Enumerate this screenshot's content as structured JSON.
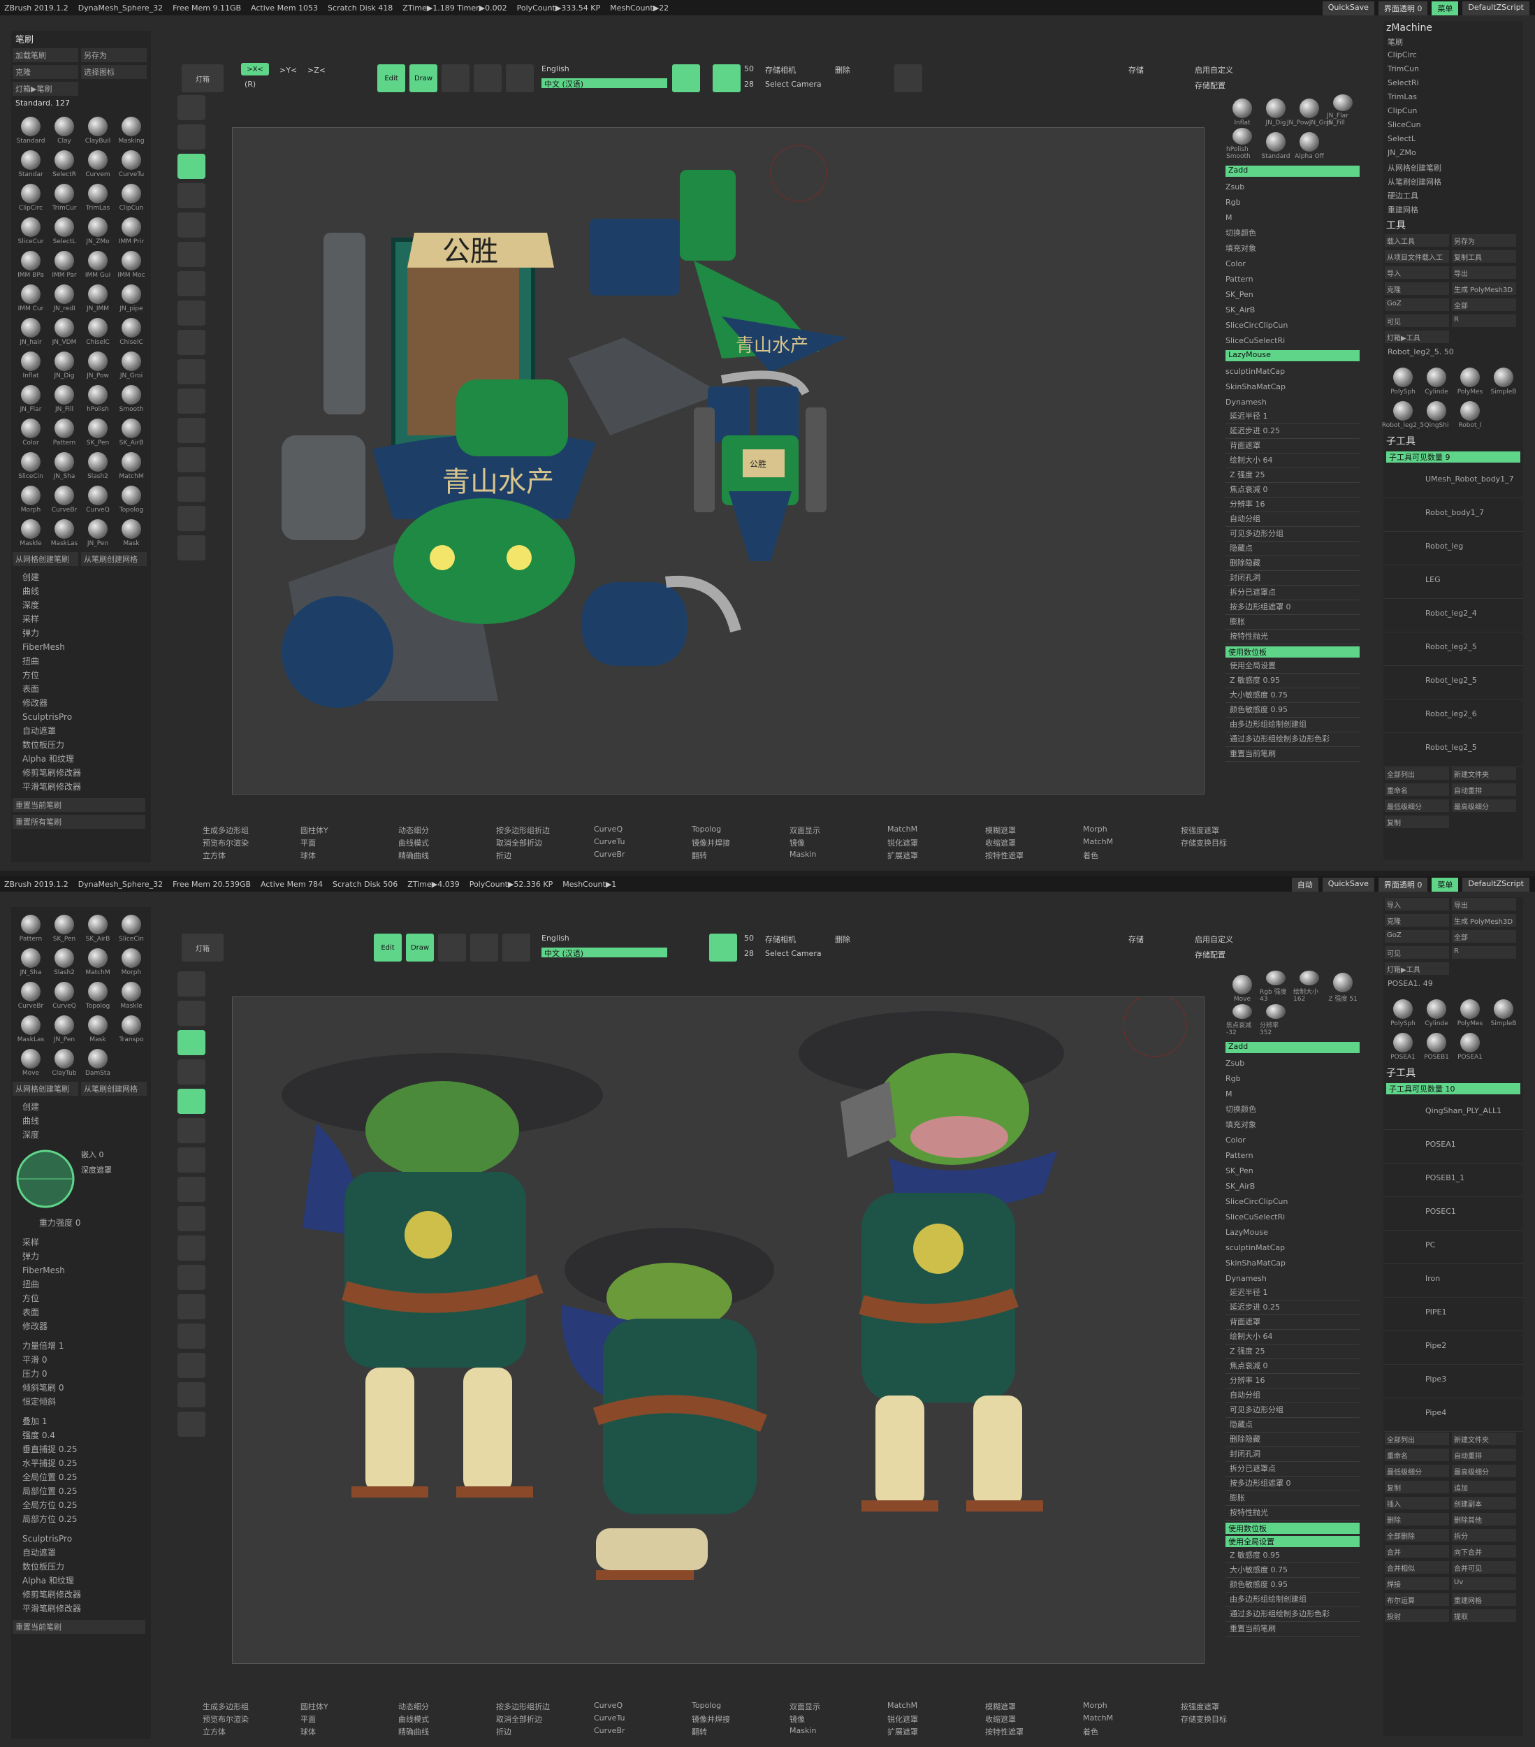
{
  "shot1": {
    "titlebar": [
      "ZBrush 2019.1.2",
      "DynaMesh_Sphere_32",
      "Free Mem 9.11GB",
      "Active Mem 1053",
      "Scratch Disk 418",
      "ZTime▶1.189 Timer▶0.002",
      "PolyCount▶333.54 KP",
      "MeshCount▶22"
    ],
    "tb_right": [
      "QuickSave",
      "界面透明 0",
      "菜单",
      "DefaultZScript"
    ],
    "left_title": "笔刷",
    "left_btns": [
      "加载笔刷",
      "另存为",
      "克隆",
      "选择图标",
      "灯箱▶笔刷"
    ],
    "brush_sel": "Standard. 127",
    "brushes": [
      "Standard",
      "Clay",
      "ClayBuil",
      "Masking",
      "Standar",
      "SelectR",
      "Curvem",
      "CurveTu",
      "ClipCirc",
      "TrimCur",
      "TrimLas",
      "ClipCun",
      "SliceCur",
      "SelectL",
      "JN_ZMo",
      "IMM Prir",
      "IMM BPa",
      "IMM Par",
      "IMM Gui",
      "IMM Moc",
      "IMM Cur",
      "JN_redI",
      "JN_IMM",
      "JN_pipe",
      "JN_hair",
      "JN_VDM",
      "ChiselC",
      "ChiselC",
      "Inflat",
      "JN_Dig",
      "JN_Pow",
      "JN_Groi",
      "JN_Flar",
      "JN_Fill",
      "hPolish",
      "Smooth",
      "Color",
      "Pattern",
      "SK_Pen",
      "SK_AirB",
      "SliceCin",
      "JN_Sha",
      "Slash2",
      "MatchM",
      "Morph",
      "CurveBr",
      "CurveQ",
      "Topolog",
      "Maskle",
      "MaskLas",
      "JN_Pen",
      "Mask"
    ],
    "left_footer": [
      "从网格创建笔刷",
      "从笔刷创建网格"
    ],
    "left_list": [
      "创建",
      "曲线",
      "深度",
      "采样",
      "弹力",
      "FiberMesh",
      "扭曲",
      "方位",
      "表面",
      "修改器",
      "SculptrisPro",
      "自动遮罩",
      "数位板压力",
      "Alpha 和纹理",
      "修剪笔刷修改器",
      "平滑笔刷修改器"
    ],
    "left_bottom": [
      "重置当前笔刷",
      "重置所有笔刷"
    ],
    "shelf": {
      "btn1": "灯箱",
      "x_sym": ">X<",
      "r": "(R)",
      "y_sym": ">Y<",
      "z_sym": ">Z<",
      "edit": "Edit",
      "draw": "Draw",
      "lang_label": "English",
      "lang": "中文 (汉语)",
      "num1": "50",
      "num2": "28",
      "store_cam": "存储相机",
      "delete": "删除",
      "select_cam": "Select Camera",
      "save": "存储",
      "custom": "启用自定义",
      "store_cfg": "存储配置"
    },
    "viewport_text": [
      "公胜",
      "青山水产",
      "青山水产",
      "公胜"
    ],
    "right_brushes": [
      "Inflat",
      "JN_Dig",
      "JN_PowJN_Groi",
      "JN_Flar JN_Fill",
      "hPolish Smooth",
      "Standard",
      "Alpha Off"
    ],
    "right_rows": [
      "Zadd",
      "Zsub",
      "Rgb",
      "M",
      "切换颜色",
      "填充对象",
      "Color",
      "Pattern",
      "SK_Pen",
      "SK_AirB",
      "SliceCircClipCun",
      "SliceCuSelectRi",
      "LazyMouse",
      "sculptinMatCap",
      "SkinShaMatCap",
      "Dynamesh"
    ],
    "right_sliders": [
      "延迟半径 1",
      "延迟步进 0.25",
      "背面遮罩",
      "绘制大小 64",
      "Z 强度 25",
      "焦点衰减 0",
      "分辨率 16",
      "自动分组",
      "可见多边形分组",
      "隐藏点",
      "删除隐藏",
      "封闭孔洞",
      "拆分已遮罩点",
      "按多边形组遮罩 0",
      "膨胀",
      "按特性抛光",
      "使用数位板",
      "使用全局设置",
      "Z 敏感度 0.95",
      "大小敏感度 0.75",
      "颜色敏感度 0.95",
      "由多边形组绘制创建组",
      "通过多边形组绘制多边形色彩",
      "重置当前笔刷"
    ],
    "far_title": "zMachine",
    "far_brush": [
      "笔刷",
      "ClipCirc",
      "TrimCun",
      "SelectRi",
      "TrimLas",
      "ClipCun",
      "SliceCun",
      "SelectL",
      "JN_ZMo",
      "从网格创建笔刷",
      "从笔刷创建网格",
      "硬边工具",
      "重建网格"
    ],
    "tool_title": "工具",
    "tool_btns": [
      "载入工具",
      "另存为",
      "从项目文件载入工具",
      "复制工具",
      "导入",
      "导出",
      "克隆",
      "生成 PolyMesh3D",
      "GoZ",
      "全部",
      "可见",
      "R",
      "灯箱▶工具"
    ],
    "tool_sel": "Robot_leg2_5. 50",
    "tool_thumbs": [
      "PolySph",
      "Cylinde",
      "PolyMes",
      "SimpleB",
      "Robot_leg2_5",
      "QingShi",
      "Robot_l"
    ],
    "subtool_title": "子工具",
    "subtool_count": "子工具可见数量 9",
    "subtools": [
      "UMesh_Robot_body1_7",
      "Robot_body1_7",
      "Robot_leg",
      "LEG",
      "Robot_leg2_4",
      "Robot_leg2_5",
      "Robot_leg2_5",
      "Robot_leg2_6",
      "Robot_leg2_5"
    ],
    "subtool_btns": [
      "全部列出",
      "新建文件夹",
      "重命名",
      "自动重排",
      "最低级细分",
      "最高级细分",
      "复制"
    ],
    "bottom": [
      "生成多边形组",
      "预览布尔渲染",
      "立方体",
      "圆柱体Y",
      "平面",
      "球体",
      "动态细分",
      "曲线模式",
      "精确曲线",
      "按多边形组折边",
      "取消全部折边",
      "折边",
      "CurveQ",
      "CurveTu",
      "CurveBr",
      "Topolog",
      "镜像并焊接",
      "翻转",
      "双面显示",
      "镜像",
      "Maskin",
      "MatchM",
      "锐化遮罩",
      "扩展遮罩",
      "模糊遮罩",
      "收缩遮罩",
      "按特性遮罩",
      "Morph",
      "MatchM",
      "着色",
      "按强度遮罩",
      "存储变换目标"
    ]
  },
  "shot2": {
    "titlebar": [
      "ZBrush 2019.1.2",
      "DynaMesh_Sphere_32",
      "Free Mem 20.539GB",
      "Active Mem 784",
      "Scratch Disk 506",
      "ZTime▶4.039",
      "PolyCount▶52.336 KP",
      "MeshCount▶1"
    ],
    "tb_right": [
      "自动",
      "QuickSave",
      "界面透明 0",
      "菜单",
      "DefaultZScript"
    ],
    "brushes": [
      "Pattern",
      "SK_Pen",
      "SK_AirB",
      "SliceCin",
      "JN_Sha",
      "Slash2",
      "MatchM",
      "Morph",
      "CurveBr",
      "CurveQ",
      "Topolog",
      "Maskle",
      "MaskLas",
      "JN_Pen",
      "Mask",
      "Transpo",
      "Move",
      "ClayTub",
      "DamSta"
    ],
    "left_footer": [
      "从网格创建笔刷",
      "从笔刷创建网格"
    ],
    "left_list1": [
      "创建",
      "曲线",
      "深度"
    ],
    "depth": [
      "嵌入 0",
      "深度遮罩",
      "重力强度 0"
    ],
    "left_list2": [
      "采样",
      "弹力",
      "FiberMesh",
      "扭曲",
      "方位",
      "表面",
      "修改器"
    ],
    "mod_rows": [
      "力量倍增 1",
      "平滑 0",
      "压力 0",
      "倾斜笔刷 0",
      "恒定倾斜"
    ],
    "mod_rows2": [
      "叠加 1",
      "强度 0.4",
      "垂直捕捉 0.25",
      "水平捕捉 0.25",
      "全局位置 0.25",
      "局部位置 0.25",
      "全局方位 0.25",
      "局部方位 0.25"
    ],
    "left_list3": [
      "SculptrisPro",
      "自动遮罩",
      "数位板压力",
      "Alpha 和纹理",
      "修剪笔刷修改器",
      "平滑笔刷修改器"
    ],
    "left_bottom": "重置当前笔刷",
    "right_extra": [
      "Move",
      "Rgb 强度 43",
      "绘制大小 162",
      "Z 强度 51",
      "焦点衰减 -32",
      "分辨率 352"
    ],
    "far_btns": [
      "导入",
      "导出",
      "克隆",
      "生成 PolyMesh3D",
      "GoZ",
      "全部",
      "可见",
      "R",
      "灯箱▶工具"
    ],
    "tool_sel": "POSEA1. 49",
    "tool_thumbs": [
      "PolySph",
      "Cylinde",
      "PolyMes",
      "SimpleB",
      "POSEA1",
      "POSEB1",
      "POSEA1"
    ],
    "subtool_count": "子工具可见数量 10",
    "subtools": [
      "QingShan_PLY_ALL1",
      "POSEA1",
      "POSEB1_1",
      "POSEC1",
      "PC",
      "Iron",
      "PIPE1",
      "Pipe2",
      "Pipe3",
      "Pipe4"
    ],
    "subtool_btns": [
      "全部列出",
      "新建文件夹",
      "重命名",
      "自动重排",
      "最低级细分",
      "最高级细分",
      "复制",
      "追加",
      "插入",
      "创建副本",
      "删除",
      "删除其他",
      "全部删除",
      "拆分",
      "合并",
      "向下合并",
      "合并相似",
      "合并可见",
      "焊接",
      "Uv",
      "布尔运算",
      "重建网格",
      "投射",
      "提取"
    ]
  }
}
